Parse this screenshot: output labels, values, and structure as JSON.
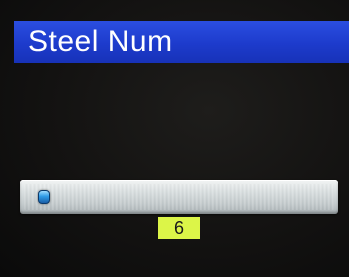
{
  "header": {
    "title": "Steel Num"
  },
  "slider": {
    "value": 6,
    "fill_fraction": 0.0
  },
  "value_display": "6",
  "colors": {
    "title_bar": "#1d3bcc",
    "value_box": "#dcf548",
    "thumb": "#2f9be6"
  }
}
